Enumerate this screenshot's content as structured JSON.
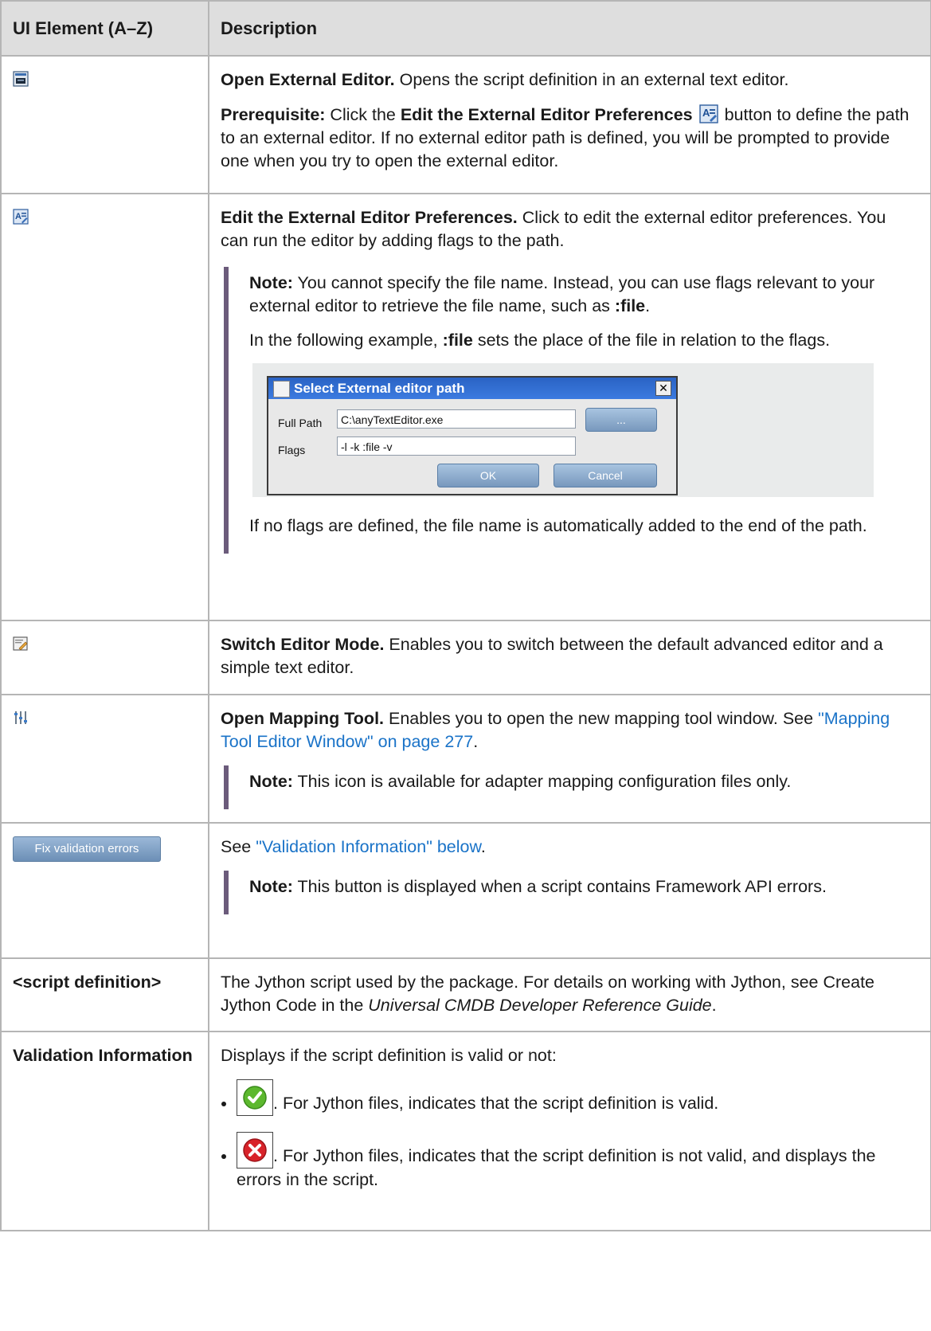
{
  "headers": {
    "element": "UI Element (A–Z)",
    "description": "Description"
  },
  "rows": {
    "open_external": {
      "icon": "external-editor-icon",
      "title": "Open External Editor.",
      "text": " Opens the script definition in an external text editor.",
      "prereq_label": "Prerequisite:",
      "prereq_pre": " Click the ",
      "prereq_bold": "Edit the External Editor Preferences",
      "prereq_post": " button to define the path to an external editor. If no external editor path is defined, you will be prompted to provide one when you try to open the external editor."
    },
    "edit_prefs": {
      "icon": "editor-preferences-icon",
      "title": "Edit the External Editor Preferences.",
      "text": " Click to edit the external editor preferences. You can run the editor by adding flags to the path.",
      "note_label": "Note:",
      "note_text": "  You cannot specify the file name. Instead, you can use flags relevant to your external editor to retrieve the file name, such as ",
      "note_flag": ":file",
      "note_end": ".",
      "example_pre": "In the following example, ",
      "example_flag": ":file",
      "example_post": " sets the place of the file in relation to the flags.",
      "after_text": "If no flags are defined, the file name is automatically added to the end of the path.",
      "dialog": {
        "title": "Select External editor path",
        "close": "✕",
        "full_path_label": "Full Path",
        "full_path_value": "C:\\anyTextEditor.exe",
        "browse_label": "...",
        "flags_label": "Flags",
        "flags_value": "-l -k :file -v",
        "ok_label": "OK",
        "cancel_label": "Cancel"
      }
    },
    "switch_mode": {
      "icon": "switch-editor-mode-icon",
      "title": "Switch Editor Mode.",
      "text": " Enables you to switch between the default advanced editor and a simple text editor."
    },
    "mapping_tool": {
      "icon": "mapping-tool-icon",
      "title": "Open Mapping Tool.",
      "text": " Enables you to open the new mapping tool window. See ",
      "link": "\"Mapping Tool Editor Window\" on page 277",
      "text_end": ".",
      "note_label": "Note:",
      "note_text": " This icon is available for adapter mapping configuration files only."
    },
    "fix_errors": {
      "button_label": "Fix validation errors",
      "see": "See ",
      "link": "\"Validation Information\" below",
      "see_end": ".",
      "note_label": "Note:",
      "note_text": " This button is displayed when a script contains Framework API errors."
    },
    "script_def": {
      "element": "<script definition>",
      "text": "The Jython script used by the package. For details on working with Jython, see Create Jython Code in the ",
      "italic": "Universal CMDB Developer Reference Guide",
      "text_end": "."
    },
    "validation": {
      "element": "Validation Information",
      "intro": "Displays if the script definition is valid or not:",
      "valid_text": ". For Jython files, indicates that the script definition is valid.",
      "invalid_text": ". For Jython files, indicates that the script definition is not valid, and displays the errors in the script.",
      "valid_color": "#5cb82e",
      "invalid_color": "#d8232a"
    }
  }
}
